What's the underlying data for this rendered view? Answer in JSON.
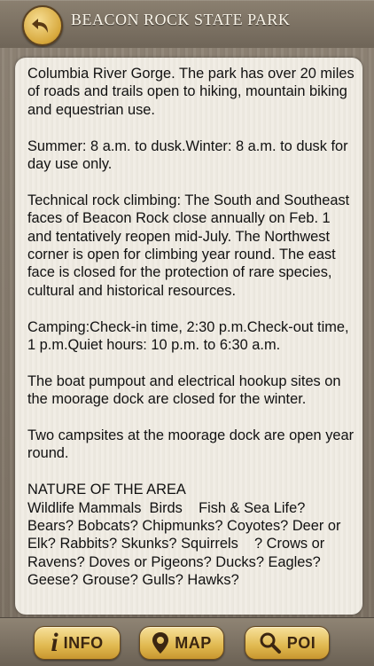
{
  "header": {
    "title": "BEACON ROCK STATE PARK",
    "back_icon": "back-arrow-icon"
  },
  "content": {
    "paragraphs": [
      "Columbia River Gorge. The park has over 20 miles of roads and trails open to hiking, mountain biking and equestrian use.",
      "Summer: 8 a.m. to dusk.Winter: 8 a.m. to dusk for day use only.",
      "Technical rock climbing: The South and Southeast faces of Beacon Rock close annually on Feb. 1 and tentatively reopen mid-July. The Northwest corner is open for climbing year round. The east face is closed for the protection of rare species, cultural and historical resources.",
      "Camping:Check-in time, 2:30 p.m.Check-out time, 1 p.m.Quiet hours: 10 p.m. to 6:30 a.m.",
      "The boat pumpout and electrical hookup sites on the moorage dock are closed for the winter.",
      "Two campsites at the moorage dock are open year round.",
      "NATURE OF THE AREA\nWildlife Mammals  Birds    Fish & Sea Life?\nBears? Bobcats? Chipmunks? Coyotes? Deer or Elk? Rabbits? Skunks? Squirrels    ? Crows or Ravens? Doves or Pigeons? Ducks? Eagles? Geese? Grouse? Gulls? Hawks?"
    ]
  },
  "footer": {
    "info": {
      "label": "INFO",
      "icon_glyph": "i",
      "icon": "info-icon"
    },
    "map": {
      "label": "MAP",
      "icon": "map-pin-icon"
    },
    "poi": {
      "label": "POI",
      "icon": "search-icon"
    }
  },
  "colors": {
    "header_bg": "#7d7264",
    "button_gold": "#e0b84f",
    "card_bg": "#f1ede5"
  }
}
